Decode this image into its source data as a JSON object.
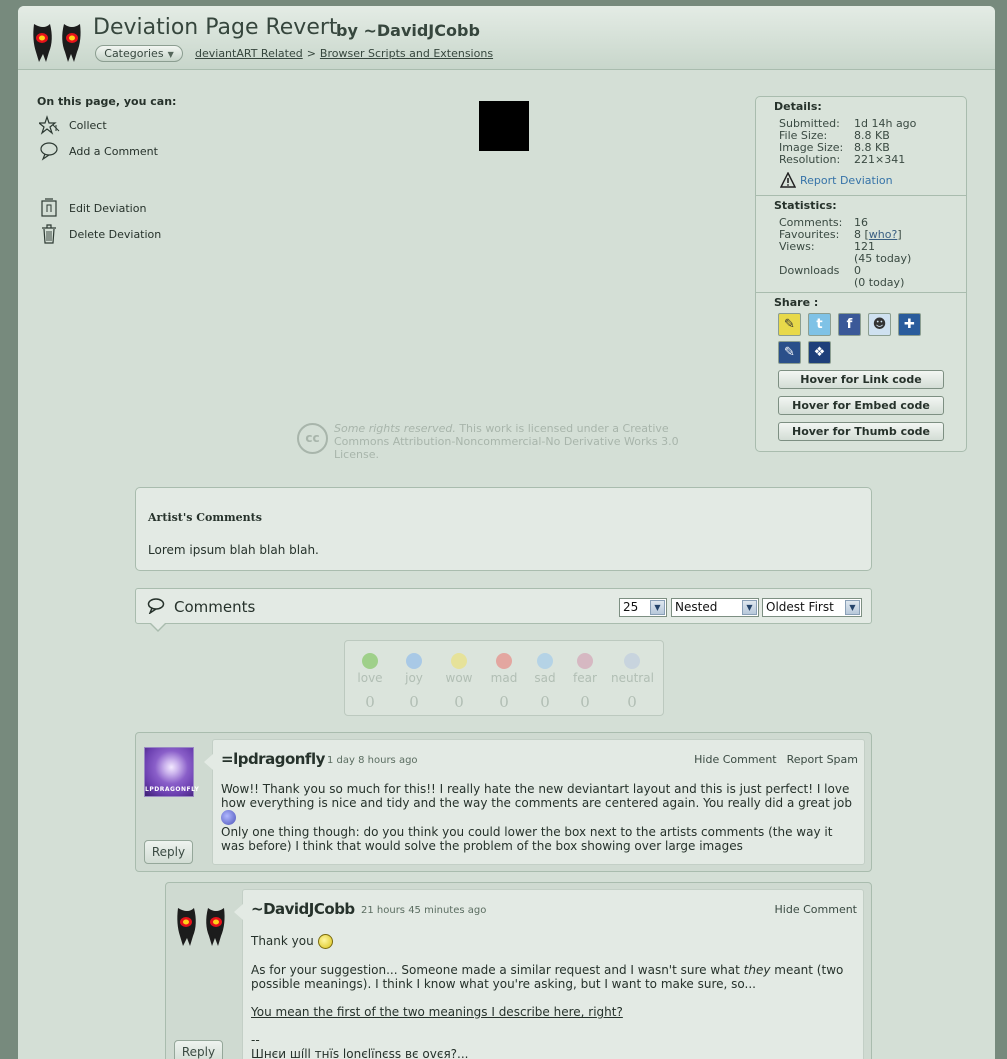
{
  "header": {
    "title": "Deviation Page Revert",
    "by": "by ~DavidJCobb",
    "categories_label": "Categories",
    "breadcrumb": [
      "deviantART Related",
      "Browser Scripts and Extensions"
    ],
    "breadcrumb_sep": ">"
  },
  "actions": {
    "title": "On this page, you can:",
    "items": [
      {
        "label": "Collect",
        "icon": "collect-icon"
      },
      {
        "label": "Add a Comment",
        "icon": "comment-icon"
      },
      {
        "label": "Edit Deviation",
        "icon": "edit-icon"
      },
      {
        "label": "Delete Deviation",
        "icon": "trash-icon"
      }
    ]
  },
  "license": {
    "icon_text": "cc",
    "rights": "Some rights reserved.",
    "text": " This work is licensed under a Creative Commons Attribution-Noncommercial-No Derivative Works 3.0 License."
  },
  "details": {
    "title": "Details:",
    "rows": [
      {
        "k": "Submitted:",
        "v": "1d 14h ago"
      },
      {
        "k": "File Size:",
        "v": "8.8 KB"
      },
      {
        "k": "Image Size:",
        "v": "8.8 KB"
      },
      {
        "k": "Resolution:",
        "v": "221×341"
      }
    ],
    "report_label": "Report Deviation",
    "stats_title": "Statistics:",
    "stats": {
      "comments_k": "Comments:",
      "comments_v": "16",
      "favourites_k": "Favourites:",
      "favourites_v": "8 [",
      "favourites_who": "who?",
      "favourites_end": "]",
      "views_k": "Views:",
      "views_v": "121",
      "views_today": "(45 today)",
      "downloads_k": "Downloads",
      "downloads_v": "0",
      "downloads_today": "(0 today)"
    },
    "share_title": "Share :",
    "share_icons": [
      "note-icon",
      "twitter-icon",
      "facebook-icon",
      "reddit-icon",
      "delicious-icon",
      "edit-share-icon",
      "myspace-icon"
    ],
    "buttons": [
      "Hover for Link code",
      "Hover for Embed code",
      "Hover for Thumb code"
    ]
  },
  "artist_comments": {
    "title": "Artist's Comments",
    "body": "Lorem ipsum blah blah blah."
  },
  "comments": {
    "title": "Comments",
    "per_page": "25",
    "view": "Nested",
    "order": "Oldest First"
  },
  "moods": [
    {
      "name": "love",
      "count": "0",
      "color": "#9fd08a"
    },
    {
      "name": "joy",
      "count": "0",
      "color": "#a9c9e6"
    },
    {
      "name": "wow",
      "count": "0",
      "color": "#e6e29a"
    },
    {
      "name": "mad",
      "count": "0",
      "color": "#e3a6a0"
    },
    {
      "name": "sad",
      "count": "0",
      "color": "#b5d3e6"
    },
    {
      "name": "fear",
      "count": "0",
      "color": "#d6b8c2"
    },
    {
      "name": "neutral",
      "count": "0",
      "color": "#c8d4de"
    }
  ],
  "comment1": {
    "user": "=lpdragonfly",
    "time": "1 day 8 hours ago",
    "hide": "Hide Comment",
    "spam": "Report Spam",
    "avatar_text": "LPDRAGONFLY",
    "body1": "Wow!! Thank you so much for this!! I really hate the new deviantart layout and this is just perfect! I love how everything is nice and tidy and the way the comments are centered again. You really did a great job",
    "body2": "Only one thing though: do you think you could lower the box next to the artists comments (the way it was before) I think that would solve the problem of the box showing over large images",
    "reply": "Reply"
  },
  "comment2": {
    "user": "~DavidJCobb",
    "time": "21 hours 45 minutes ago",
    "hide": "Hide Comment",
    "line1": "Thank you",
    "line2a": "As for your suggestion... Someone made a similar request and I wasn't sure what ",
    "line2em": "they",
    "line2b": " meant (two possible meanings). I think I know what you're asking, but I want to make sure, so...",
    "link": "You mean the first of the two meanings I describe here, right?",
    "sig_dash": "--",
    "sig": "Шнєи ші́ll тнїs lonєlїnєss вє ovєя?...",
    "reply": "Reply"
  }
}
